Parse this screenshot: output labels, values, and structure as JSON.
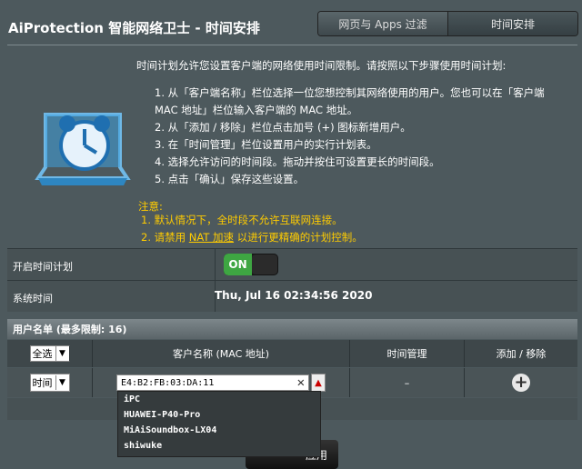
{
  "header": {
    "title": "AiProtection 智能网络卫士 - 时间安排"
  },
  "tabs": [
    {
      "label": "网页与 Apps 过滤",
      "active": false
    },
    {
      "label": "时间安排",
      "active": true
    }
  ],
  "intro": "时间计划允许您设置客户端的网络使用时间限制。请按照以下步骤使用时间计划:",
  "steps": [
    "1.  从「客户端名称」栏位选择一位您想控制其网络使用的用户。您也可以在「客户端",
    "     MAC 地址」栏位输入客户端的 MAC 地址。",
    "2.  从「添加 / 移除」栏位点击加号 (+) 图标新增用户。",
    "3.  在「时间管理」栏位设置用户的实行计划表。",
    "4.  选择允许访问的时间段。拖动并按住可设置更长的时间段。",
    "5.  点击「确认」保存这些设置。"
  ],
  "notes": {
    "title": "注意:",
    "note1": "1.  默认情况下，全时段不允许互联网连接。",
    "note2_prefix": "2.  请禁用 ",
    "note2_link": "NAT 加速",
    "note2_suffix": " 以进行更精确的计划控制。"
  },
  "settings": {
    "enable_label": "开启时间计划",
    "toggle_label": "ON",
    "system_time_label": "系统时间",
    "system_time_value": "Thu, Jul 16 02:34:56 2020"
  },
  "user_list": {
    "header": "用户名单 (最多限制:  16)",
    "col_select": "全选",
    "col_client": "客户名称 (MAC 地址)",
    "col_time": "时间管理",
    "col_add": "添加 / 移除",
    "row_select": "时间",
    "mac_value": "E4:B2:FB:03:DA:11",
    "time_value": "–"
  },
  "dropdown": [
    "iPC",
    "HUAWEI-P40-Pro",
    "MiAiSoundbox-LX04",
    "shiwuke"
  ],
  "apply_label": "应用"
}
